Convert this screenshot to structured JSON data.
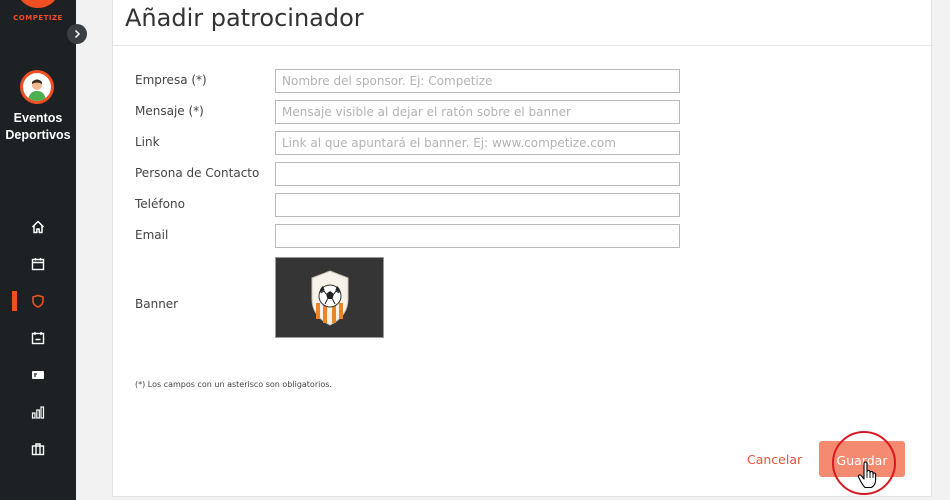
{
  "sidebar": {
    "logo_text": "COMPETIZE",
    "org_name_line1": "Eventos",
    "org_name_line2": "Deportivos",
    "nav_items": [
      "home-icon",
      "calendar-icon",
      "shield-icon",
      "ticket-icon",
      "payment-card-icon",
      "stats-icon",
      "briefcase-icon"
    ],
    "active_item": "shield-icon",
    "accent": "#f04e23"
  },
  "page": {
    "title": "Añadir patrocinador"
  },
  "form": {
    "empresa": {
      "label": "Empresa (*)",
      "placeholder": "Nombre del sponsor. Ej: Competize",
      "value": ""
    },
    "mensaje": {
      "label": "Mensaje (*)",
      "placeholder": "Mensaje visible al dejar el ratón sobre el banner",
      "value": ""
    },
    "link": {
      "label": "Link",
      "placeholder": "Link al que apuntará el banner. Ej: www.competize.com",
      "value": ""
    },
    "contacto": {
      "label": "Persona de Contacto",
      "placeholder": "",
      "value": ""
    },
    "telefono": {
      "label": "Teléfono",
      "placeholder": "",
      "value": ""
    },
    "email": {
      "label": "Email",
      "placeholder": "",
      "value": ""
    },
    "banner_label": "Banner",
    "required_note": "(*) Los campos con un asterisco son obligatorios."
  },
  "actions": {
    "cancel_label": "Cancelar",
    "save_label": "Guardar"
  }
}
